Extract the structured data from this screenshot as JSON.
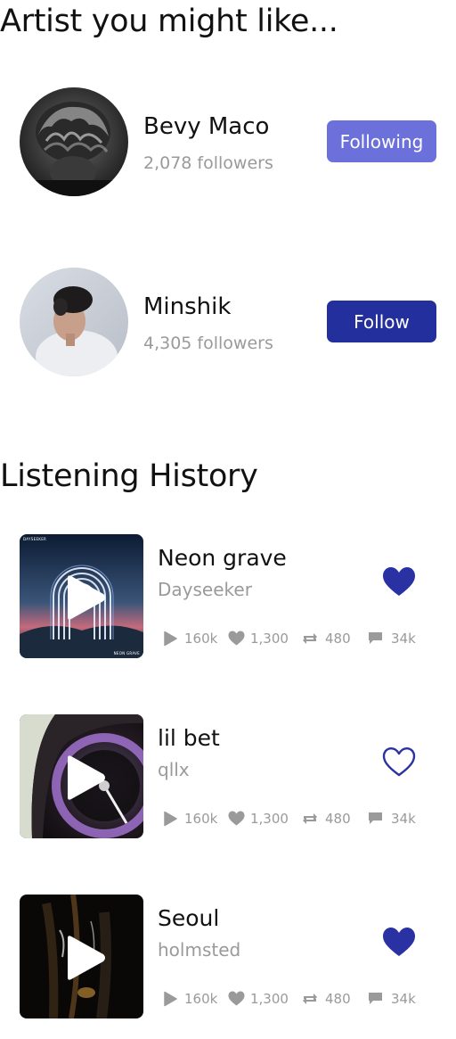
{
  "colors": {
    "following_bg": "#6b70da",
    "follow_bg": "#232f9c",
    "heart": "#2a31a3",
    "muted_text": "#9a9a9a"
  },
  "artists_section": {
    "title": "Artist you might like...",
    "artists": [
      {
        "name": "Bevy Maco",
        "followers": "2,078 followers",
        "button_label": "Following",
        "following": true
      },
      {
        "name": "Minshik",
        "followers": "4,305 followers",
        "button_label": "Follow",
        "following": false
      }
    ]
  },
  "history_section": {
    "title": "Listening History",
    "tracks": [
      {
        "title": "Neon grave",
        "artist": "Dayseeker",
        "liked": true,
        "cover_text_top": "DAYSEEKER",
        "cover_text_bottom": "NEON GRAVE",
        "plays": "160k",
        "likes": "1,300",
        "reposts": "480",
        "comments": "34k"
      },
      {
        "title": "lil bet",
        "artist": "qllx",
        "liked": false,
        "plays": "160k",
        "likes": "1,300",
        "reposts": "480",
        "comments": "34k"
      },
      {
        "title": "Seoul",
        "artist": "holmsted",
        "liked": true,
        "plays": "160k",
        "likes": "1,300",
        "reposts": "480",
        "comments": "34k"
      }
    ]
  },
  "icons": {
    "play": "play-icon",
    "plays_stat": "play-count-icon",
    "likes_stat": "heart-count-icon",
    "reposts_stat": "repost-icon",
    "comments_stat": "comment-icon",
    "like": "heart-icon"
  }
}
